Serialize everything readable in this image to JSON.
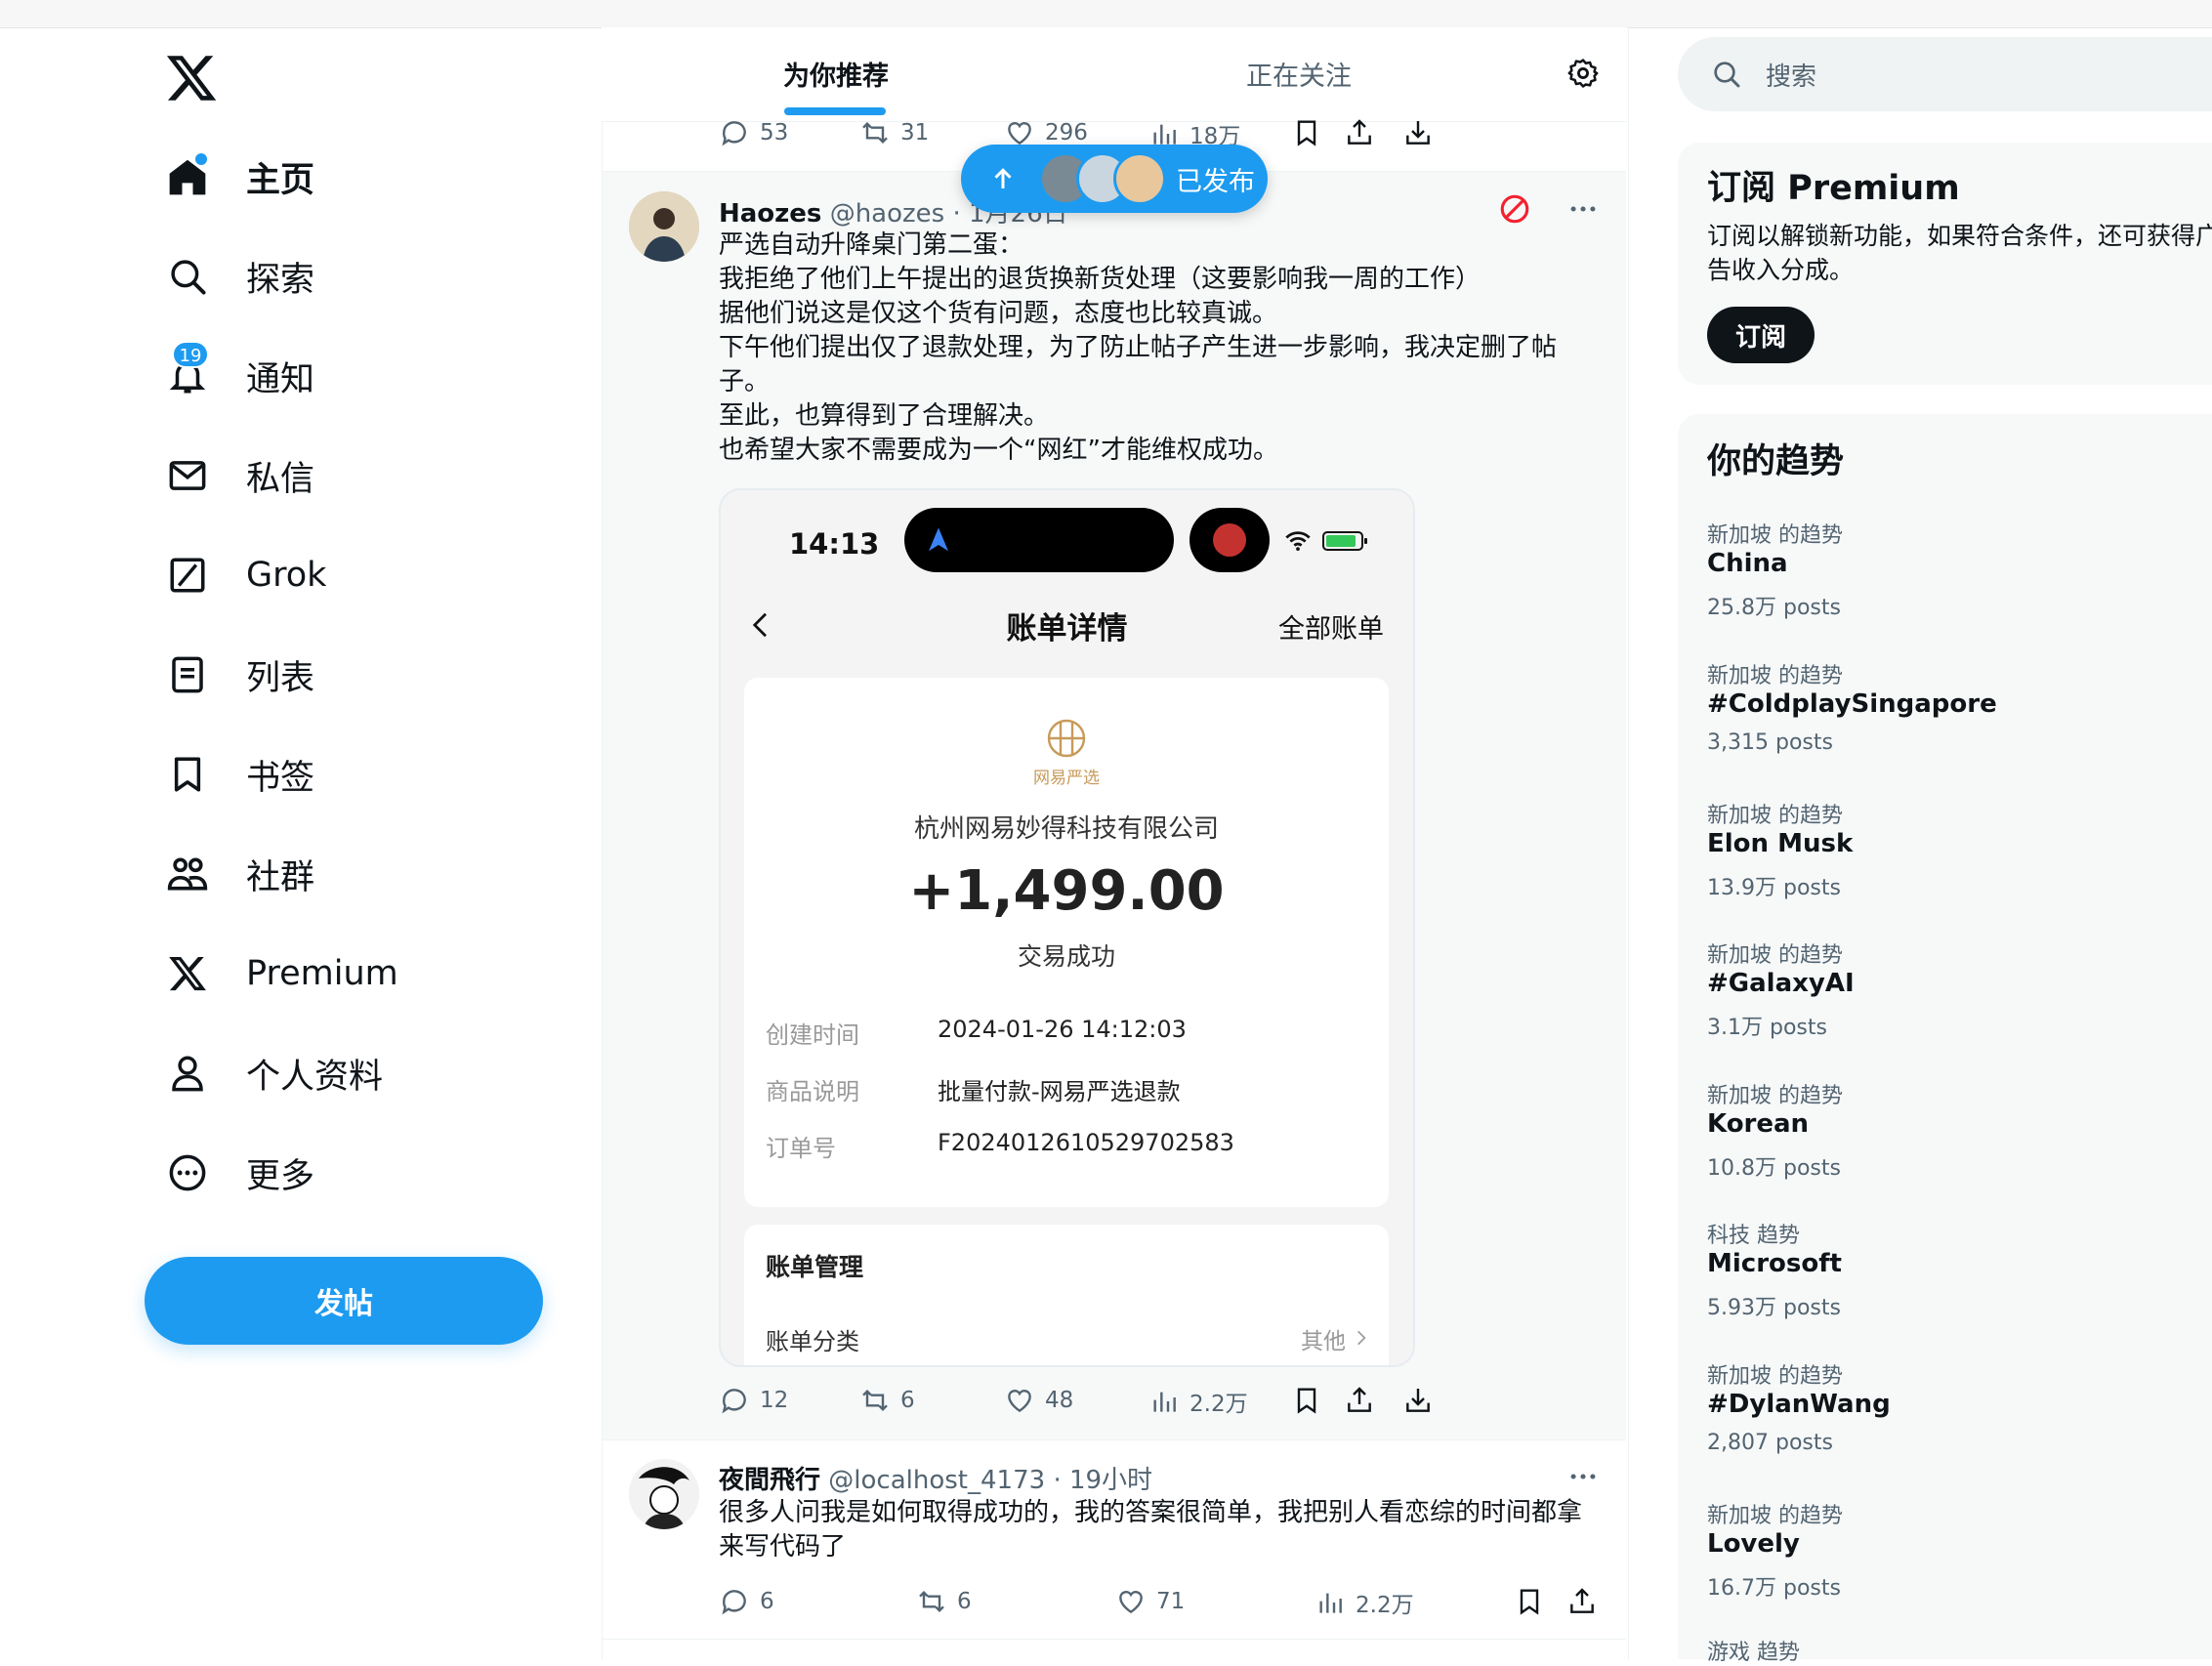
{
  "colors": {
    "accent": "#1d9bf0",
    "text": "#0f1419",
    "muted": "#536471",
    "danger": "#f4212e"
  },
  "nav": {
    "logo": "x-logo-icon",
    "items": [
      {
        "label": "主页",
        "icon": "home-icon",
        "active": true
      },
      {
        "label": "探索",
        "icon": "search-icon"
      },
      {
        "label": "通知",
        "icon": "bell-icon",
        "badge": "19"
      },
      {
        "label": "私信",
        "icon": "envelope-icon"
      },
      {
        "label": "Grok",
        "icon": "grok-icon"
      },
      {
        "label": "列表",
        "icon": "list-icon"
      },
      {
        "label": "书签",
        "icon": "bookmark-icon"
      },
      {
        "label": "社群",
        "icon": "communities-icon"
      },
      {
        "label": "Premium",
        "icon": "x-logo-icon"
      },
      {
        "label": "个人资料",
        "icon": "person-icon"
      },
      {
        "label": "更多",
        "icon": "more-circle-icon"
      }
    ],
    "post_button": "发帖"
  },
  "tabs": {
    "for_you": "为你推荐",
    "following": "正在关注",
    "settings_icon": "gear-icon"
  },
  "new_posts_pill": {
    "label": "已发布",
    "icon": "arrow-up-icon"
  },
  "prev_tweet_actions": {
    "replies": "53",
    "reposts": "31",
    "likes": "296",
    "views": "18万"
  },
  "tweet1": {
    "name": "Haozes",
    "handle": "@haozes",
    "time": "· 1月26日",
    "lines": [
      "严选自动升降桌门第二蛋：",
      "我拒绝了他们上午提出的退货换新货处理（这要影响我一周的工作）",
      "据他们说这是仅这个货有问题，态度也比较真诚。",
      "下午他们提出仅了退款处理，为了防止帖子产生进一步影响，我决定删了帖",
      "子。",
      "至此，也算得到了合理解决。",
      "也希望大家不需要成为一个“网红”才能维权成功。"
    ],
    "actions": {
      "replies": "12",
      "reposts": "6",
      "likes": "48",
      "views": "2.2万"
    }
  },
  "receipt": {
    "clock": "14:13",
    "title": "账单详情",
    "all_bills": "全部账单",
    "brand": "网易严选",
    "merchant": "杭州网易妙得科技有限公司",
    "amount": "+1,499.00",
    "status": "交易成功",
    "rows": [
      {
        "k": "创建时间",
        "v": "2024-01-26 14:12:03"
      },
      {
        "k": "商品说明",
        "v": "批量付款-网易严选退款"
      },
      {
        "k": "订单号",
        "v": "F2024012610529702583"
      }
    ],
    "manage_title": "账单管理",
    "category_label": "账单分类",
    "category_value": "其他"
  },
  "tweet2": {
    "name": "夜間飛行",
    "handle": "@localhost_4173",
    "time": "· 19小时",
    "lines": [
      "很多人问我是如何取得成功的，我的答案很简单，我把别人看恋综的时间都拿",
      "来写代码了"
    ],
    "actions": {
      "replies": "6",
      "reposts": "6",
      "likes": "71",
      "views": "2.2万"
    }
  },
  "search": {
    "placeholder": "搜索"
  },
  "premium": {
    "title": "订阅 Premium",
    "line1": "订阅以解锁新功能，如果符合条件，还可获得广",
    "line2": "告收入分成。",
    "button": "订阅"
  },
  "trends": {
    "title": "你的趋势",
    "items": [
      {
        "context": "新加坡 的趋势",
        "name": "China",
        "count": "25.8万 posts"
      },
      {
        "context": "新加坡 的趋势",
        "name": "#ColdplaySingapore",
        "count": "3,315 posts"
      },
      {
        "context": "新加坡 的趋势",
        "name": "Elon Musk",
        "count": "13.9万 posts"
      },
      {
        "context": "新加坡 的趋势",
        "name": "#GalaxyAI",
        "count": "3.1万 posts"
      },
      {
        "context": "新加坡 的趋势",
        "name": "Korean",
        "count": "10.8万 posts"
      },
      {
        "context": "科技 趋势",
        "name": "Microsoft",
        "count": "5.93万 posts"
      },
      {
        "context": "新加坡 的趋势",
        "name": "#DylanWang",
        "count": "2,807 posts"
      },
      {
        "context": "新加坡 的趋势",
        "name": "Lovely",
        "count": "16.7万 posts"
      },
      {
        "context": "游戏 趋势",
        "name": "",
        "count": ""
      }
    ]
  }
}
